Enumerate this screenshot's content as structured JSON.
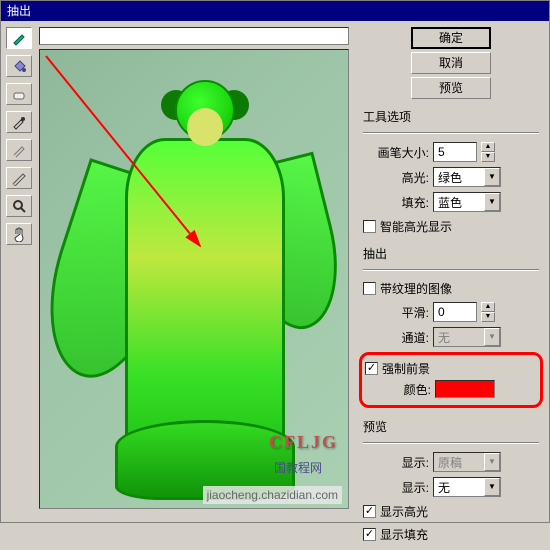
{
  "title": "抽出",
  "buttons": {
    "ok": "确定",
    "cancel": "取消",
    "preview": "预览"
  },
  "section_tool_options": "工具选项",
  "brush_size": {
    "label": "画笔大小:",
    "value": "5"
  },
  "highlight": {
    "label": "高光:",
    "value": "绿色"
  },
  "fill": {
    "label": "填充:",
    "value": "蓝色"
  },
  "smart_highlight": {
    "label": "智能高光显示",
    "checked": false
  },
  "section_extract": "抽出",
  "textured": {
    "label": "带纹理的图像",
    "checked": false
  },
  "smooth": {
    "label": "平滑:",
    "value": "0"
  },
  "channel": {
    "label": "通道:",
    "value": "无"
  },
  "force_fg": {
    "label": "强制前景",
    "checked": true
  },
  "color": {
    "label": "颜色:",
    "value": "#ff0000"
  },
  "section_preview": "预览",
  "show": {
    "label": "显示:",
    "value": "原稿"
  },
  "display": {
    "label": "显示:",
    "value": "无"
  },
  "show_highlight": {
    "label": "显示高光",
    "checked": true
  },
  "show_fill": {
    "label": "显示填充",
    "checked": true
  },
  "watermark": {
    "logo_top": "国教程网",
    "cfljg": "CFLJG",
    "bottom": "jiaocheng.chazidian.com"
  }
}
